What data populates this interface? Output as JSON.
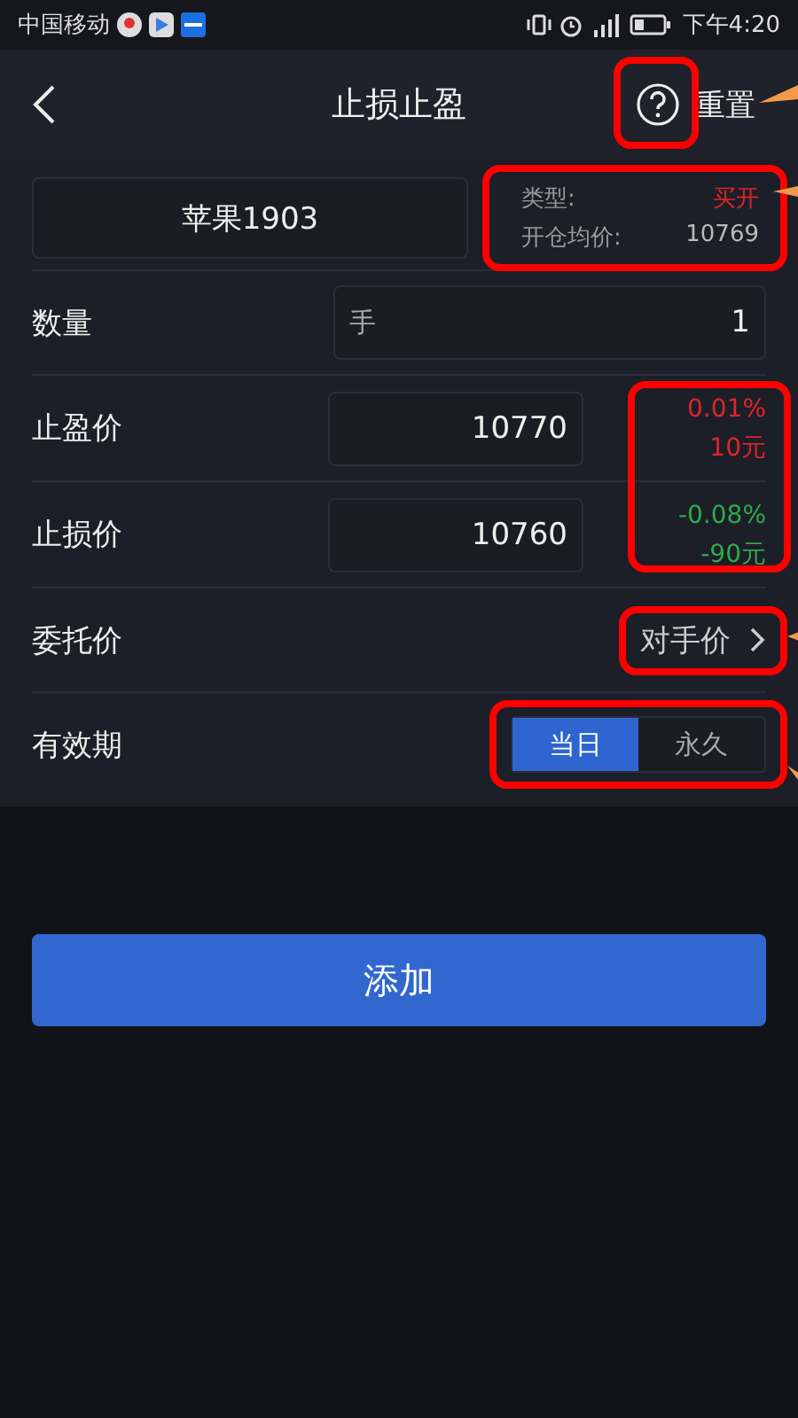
{
  "status_bar": {
    "carrier": "中国移动",
    "time": "下午4:20"
  },
  "header": {
    "title": "止损止盈",
    "reset": "重置",
    "help_highlighted": true
  },
  "contract": {
    "name": "苹果1903",
    "type_label": "类型:",
    "type_value": "买开",
    "avg_label": "开仓均价:",
    "avg_value": "10769",
    "highlighted": true
  },
  "quantity": {
    "label": "数量",
    "unit": "手",
    "value": "1"
  },
  "prices": {
    "highlighted": true,
    "rows": [
      {
        "label": "止盈价",
        "value": "10770",
        "percent": "0.01%",
        "amount": "10元",
        "color": "#e0242b"
      },
      {
        "label": "止损价",
        "value": "10760",
        "percent": "-0.08%",
        "amount": "-90元",
        "color": "#2fa94a"
      }
    ]
  },
  "order_price": {
    "label": "委托价",
    "value": "对手价",
    "highlighted": true
  },
  "validity": {
    "label": "有效期",
    "highlighted": true,
    "options": [
      {
        "label": "当日",
        "selected": true
      },
      {
        "label": "永久",
        "selected": false
      }
    ]
  },
  "button": "添加"
}
